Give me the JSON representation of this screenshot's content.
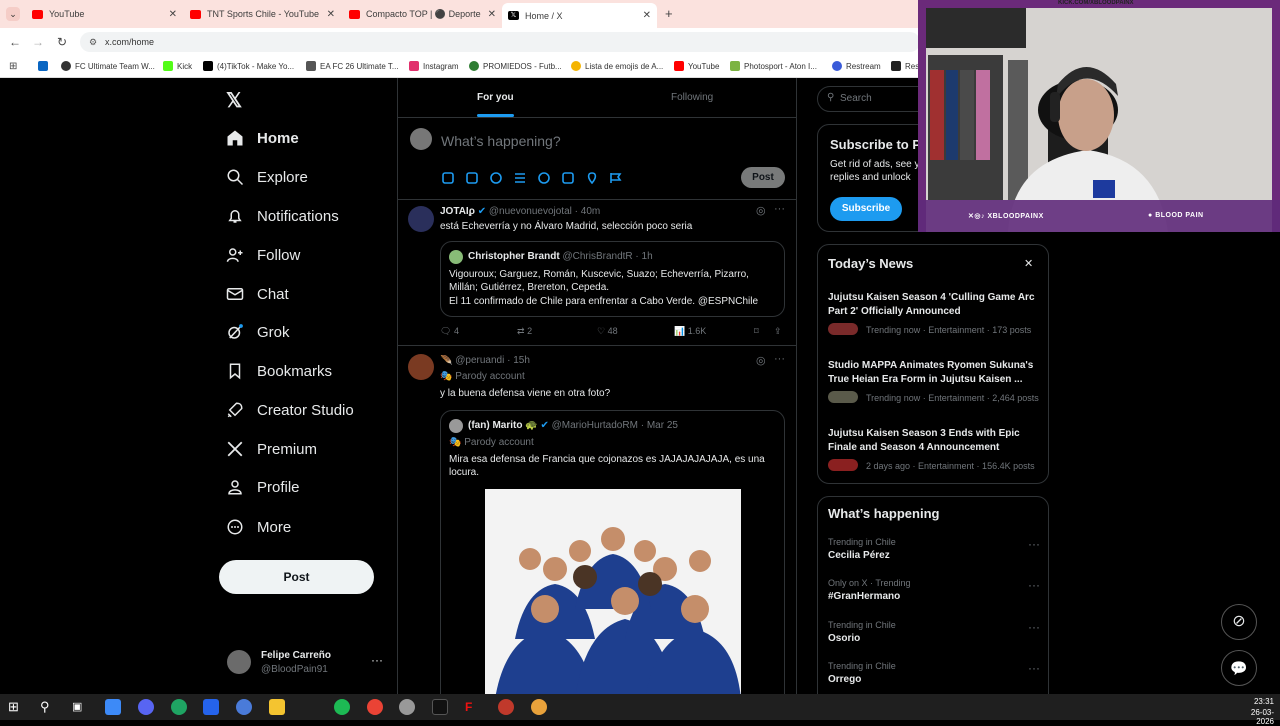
{
  "browser": {
    "tabs": [
      {
        "title": "YouTube",
        "color": "#ff0000"
      },
      {
        "title": "TNT Sports Chile - YouTube",
        "color": "#ff0000"
      },
      {
        "title": "Compacto TOP | ⚫ Deporte",
        "color": "#ff0000"
      },
      {
        "title": "Home / X",
        "color": "#000000"
      }
    ],
    "url": "x.com/home",
    "bookmarks": [
      "FC Ultimate Team W...",
      "Kick",
      "(4)TikTok - Make Yo...",
      "EA FC 26 Ultimate T...",
      "Instagram",
      "PROMIEDOS - Futb...",
      "Lista de emojis de A...",
      "YouTube",
      "Photosport - Aton I...",
      "Restream",
      "Res"
    ]
  },
  "sidebar": {
    "items": [
      {
        "label": "Home",
        "icon": "home-icon"
      },
      {
        "label": "Explore",
        "icon": "search-icon"
      },
      {
        "label": "Notifications",
        "icon": "bell-icon"
      },
      {
        "label": "Follow",
        "icon": "person-add-icon"
      },
      {
        "label": "Chat",
        "icon": "mail-icon"
      },
      {
        "label": "Grok",
        "icon": "grok-icon"
      },
      {
        "label": "Bookmarks",
        "icon": "bookmark-icon"
      },
      {
        "label": "Creator Studio",
        "icon": "rocket-icon"
      },
      {
        "label": "Premium",
        "icon": "x-logo-icon"
      },
      {
        "label": "Profile",
        "icon": "user-icon"
      },
      {
        "label": "More",
        "icon": "more-circle-icon"
      }
    ],
    "post_label": "Post",
    "user": {
      "name": "Felipe Carreño",
      "handle": "@BloodPain91"
    }
  },
  "timeline": {
    "tabs": [
      "For you",
      "Following"
    ],
    "composer_placeholder": "What’s happening?",
    "composer_post": "Post",
    "posts": [
      {
        "name": "JOTAIϼ",
        "handle": "@nuevonuevojotal",
        "time": "40m",
        "text": "está Echeverría y no Álvaro Madrid, selección poco seria",
        "quote": {
          "name": "Christopher Brandt",
          "handle": "@ChrisBrandtR",
          "time": "1h",
          "line1": "Vigouroux; Garguez, Román, Kuscevic, Suazo; Echeverría, Pizarro,",
          "line2": "Millán; Gutiérrez, Brereton, Cepeda.",
          "line3": "El 11 confirmado de Chile para enfrentar a Cabo Verde. @ESPNChile"
        },
        "stats": {
          "replies": "4",
          "reposts": "2",
          "likes": "48",
          "views": "1.6K"
        }
      },
      {
        "name": "🪶",
        "handle": "@peruandi",
        "time": "15h",
        "badge": "Parody account",
        "text": "y la buena defensa viene en otra foto?",
        "quote": {
          "name": "(fan) Marito 🐢",
          "handle": "@MarioHurtadoRM",
          "time": "Mar 25",
          "badge": "Parody account",
          "line1": "Mira esa defensa de Francia que cojonazos es JAJAJAJAJAJA, es una",
          "line2": "locura."
        }
      }
    ]
  },
  "right": {
    "search_placeholder": "Search",
    "subscribe": {
      "title": "Subscribe to P",
      "desc1": "Get rid of ads, see y",
      "desc2": "replies and unlock",
      "button": "Subscribe"
    },
    "news": {
      "title": "Today’s News",
      "items": [
        {
          "title1": "Jujutsu Kaisen Season 4 'Culling Game Arc",
          "title2": "Part 2' Officially Announced",
          "meta": "Trending now · Entertainment · 173 posts"
        },
        {
          "title1": "Studio MAPPA Animates Ryomen Sukuna's",
          "title2": "True Heian Era Form in Jujutsu Kaisen ...",
          "meta": "Trending now · Entertainment · 2,464 posts"
        },
        {
          "title1": "Jujutsu Kaisen Season 3 Ends with Epic",
          "title2": "Finale and Season 4 Announcement",
          "meta": "2 days ago · Entertainment · 156.4K posts"
        }
      ]
    },
    "happening": {
      "title": "What’s happening",
      "items": [
        {
          "context": "Trending in Chile",
          "name": "Cecilia Pérez"
        },
        {
          "context": "Only on X · Trending",
          "name": "#GranHermano"
        },
        {
          "context": "Trending in Chile",
          "name": "Osorio"
        },
        {
          "context": "Trending in Chile",
          "name": "Orrego"
        }
      ]
    }
  },
  "webcam": {
    "top_text": "KICK.COM/XBLOODPAINX",
    "left_text": "XBLOODPAINX",
    "right_text": "BLOOD PAIN"
  },
  "taskbar": {
    "time": "23:31",
    "date": "26-03-2026"
  }
}
